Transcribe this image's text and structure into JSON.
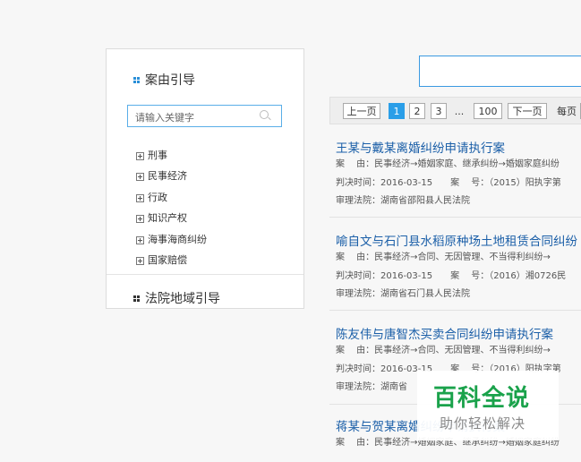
{
  "sidebar": {
    "case_guide_title": "案由引导",
    "search_placeholder": "请输入关键字",
    "tree_items": [
      "刑事",
      "民事经济",
      "行政",
      "知识产权",
      "海事海商纠纷",
      "国家赔偿"
    ],
    "court_guide_title": "法院地域引导"
  },
  "pagination": {
    "prev": "上一页",
    "pages": [
      "1",
      "2",
      "3"
    ],
    "ellipsis": "...",
    "last": "100",
    "next": "下一页",
    "per_page_label": "每页",
    "active_page": "1"
  },
  "results": [
    {
      "title": "王某与戴某离婚纠纷申请执行案",
      "cause": "案　 由：民事经济→婚姻家庭、继承纠纷→婚姻家庭纠纷",
      "date_line": "判决时间：2016-03-15　　案　 号：（2015）阳执字第",
      "court": "审理法院：湖南省邵阳县人民法院"
    },
    {
      "title": "喻自文与石门县水稻原种场土地租赁合同纠纷",
      "cause": "案　 由：民事经济→合同、无因管理、不当得利纠纷→",
      "date_line": "判决时间：2016-03-15　　案　 号：（2016）湘0726民",
      "court": "审理法院：湖南省石门县人民法院"
    },
    {
      "title": "陈友伟与唐智杰买卖合同纠纷申请执行案",
      "cause": "案　 由：民事经济→合同、无因管理、不当得利纠纷→",
      "date_line": "判决时间：2016-03-15　　案　 号：（2016）阳执字第",
      "court": "审理法院：湖南省"
    },
    {
      "title": "蒋某与贺某离婚纠纷申请执行案",
      "cause": "案　 由：民事经济→婚姻家庭、继承纠纷→婚姻家庭纠纷",
      "date_line": "",
      "court": ""
    }
  ],
  "watermark": {
    "brand": "百科全说",
    "slogan": "助你轻松解决"
  },
  "colors": {
    "accent": "#2a9ee8",
    "title_link": "#1b5fa8",
    "watermark_green": "#1aa24b"
  }
}
